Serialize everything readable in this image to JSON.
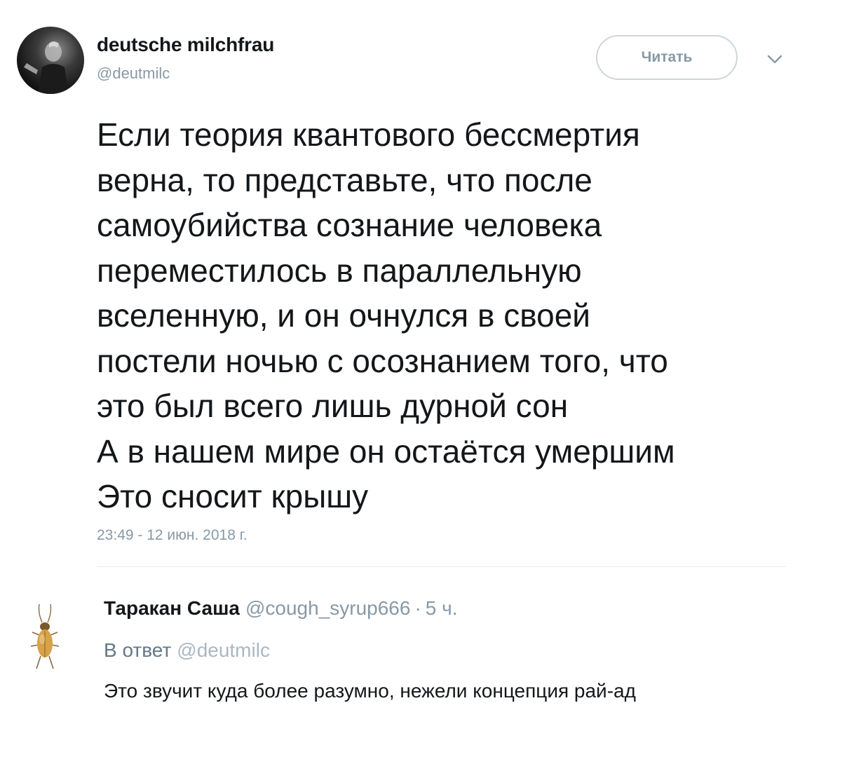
{
  "author": {
    "display_name": "deutsche milchfrau",
    "handle": "@deutmilc"
  },
  "follow_button_label": "Читать",
  "tweet": {
    "lines": [
      "Если теория квантового бессмертия",
      "верна, то представьте, что после",
      "самоубийства сознание человека",
      "переместилось в параллельную",
      "вселенную, и он очнулся в своей",
      "постели ночью с осознанием того, что",
      "это был всего лишь дурной сон",
      "А в нашем мире он остаётся умершим",
      "Это сносит крышу"
    ],
    "timestamp": "23:49 - 12 июн. 2018 г."
  },
  "reply": {
    "display_name": "Таракан Саша",
    "handle": "@cough_syrup666",
    "separator": "·",
    "time_ago": "5 ч.",
    "in_reply_to_label": "В ответ",
    "in_reply_to_handle": "@deutmilc",
    "text": "Это звучит куда более разумно, нежели концепция рай-ад"
  },
  "icons": {
    "author_avatar": "author-avatar",
    "chevron": "chevron-down-icon",
    "reply_avatar": "cockroach-avatar"
  },
  "colors": {
    "text_primary": "#14171a",
    "text_secondary": "#8899a6",
    "border": "#ccd6dd",
    "divider": "#e6ecf0"
  }
}
